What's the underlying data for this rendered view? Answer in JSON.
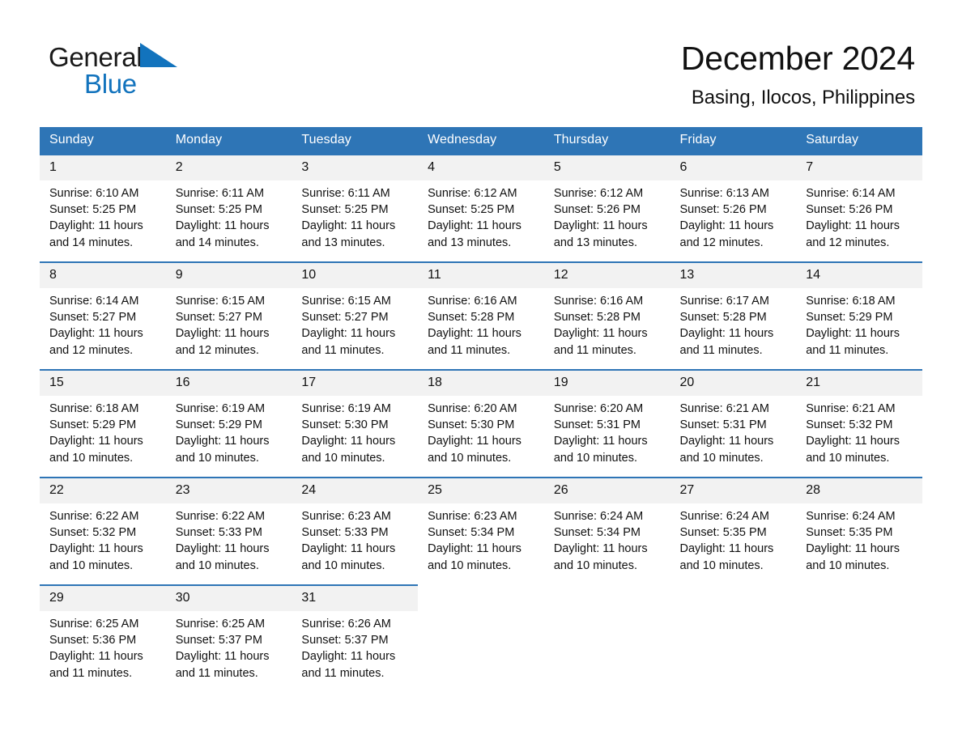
{
  "brand": {
    "name_part1": "General",
    "name_part2": "Blue",
    "triangle_color": "#1273bd",
    "text_color": "#1a1a1a"
  },
  "header": {
    "title": "December 2024",
    "subtitle": "Basing, Ilocos, Philippines"
  },
  "theme": {
    "header_blue": "#2e75b6",
    "daynum_bg": "#f2f2f2",
    "page_bg": "#ffffff",
    "text": "#111111"
  },
  "calendar": {
    "weekday_headers": [
      "Sunday",
      "Monday",
      "Tuesday",
      "Wednesday",
      "Thursday",
      "Friday",
      "Saturday"
    ],
    "weeks": [
      [
        {
          "day": "1",
          "sunrise": "Sunrise: 6:10 AM",
          "sunset": "Sunset: 5:25 PM",
          "daylight": "Daylight: 11 hours and 14 minutes."
        },
        {
          "day": "2",
          "sunrise": "Sunrise: 6:11 AM",
          "sunset": "Sunset: 5:25 PM",
          "daylight": "Daylight: 11 hours and 14 minutes."
        },
        {
          "day": "3",
          "sunrise": "Sunrise: 6:11 AM",
          "sunset": "Sunset: 5:25 PM",
          "daylight": "Daylight: 11 hours and 13 minutes."
        },
        {
          "day": "4",
          "sunrise": "Sunrise: 6:12 AM",
          "sunset": "Sunset: 5:25 PM",
          "daylight": "Daylight: 11 hours and 13 minutes."
        },
        {
          "day": "5",
          "sunrise": "Sunrise: 6:12 AM",
          "sunset": "Sunset: 5:26 PM",
          "daylight": "Daylight: 11 hours and 13 minutes."
        },
        {
          "day": "6",
          "sunrise": "Sunrise: 6:13 AM",
          "sunset": "Sunset: 5:26 PM",
          "daylight": "Daylight: 11 hours and 12 minutes."
        },
        {
          "day": "7",
          "sunrise": "Sunrise: 6:14 AM",
          "sunset": "Sunset: 5:26 PM",
          "daylight": "Daylight: 11 hours and 12 minutes."
        }
      ],
      [
        {
          "day": "8",
          "sunrise": "Sunrise: 6:14 AM",
          "sunset": "Sunset: 5:27 PM",
          "daylight": "Daylight: 11 hours and 12 minutes."
        },
        {
          "day": "9",
          "sunrise": "Sunrise: 6:15 AM",
          "sunset": "Sunset: 5:27 PM",
          "daylight": "Daylight: 11 hours and 12 minutes."
        },
        {
          "day": "10",
          "sunrise": "Sunrise: 6:15 AM",
          "sunset": "Sunset: 5:27 PM",
          "daylight": "Daylight: 11 hours and 11 minutes."
        },
        {
          "day": "11",
          "sunrise": "Sunrise: 6:16 AM",
          "sunset": "Sunset: 5:28 PM",
          "daylight": "Daylight: 11 hours and 11 minutes."
        },
        {
          "day": "12",
          "sunrise": "Sunrise: 6:16 AM",
          "sunset": "Sunset: 5:28 PM",
          "daylight": "Daylight: 11 hours and 11 minutes."
        },
        {
          "day": "13",
          "sunrise": "Sunrise: 6:17 AM",
          "sunset": "Sunset: 5:28 PM",
          "daylight": "Daylight: 11 hours and 11 minutes."
        },
        {
          "day": "14",
          "sunrise": "Sunrise: 6:18 AM",
          "sunset": "Sunset: 5:29 PM",
          "daylight": "Daylight: 11 hours and 11 minutes."
        }
      ],
      [
        {
          "day": "15",
          "sunrise": "Sunrise: 6:18 AM",
          "sunset": "Sunset: 5:29 PM",
          "daylight": "Daylight: 11 hours and 10 minutes."
        },
        {
          "day": "16",
          "sunrise": "Sunrise: 6:19 AM",
          "sunset": "Sunset: 5:29 PM",
          "daylight": "Daylight: 11 hours and 10 minutes."
        },
        {
          "day": "17",
          "sunrise": "Sunrise: 6:19 AM",
          "sunset": "Sunset: 5:30 PM",
          "daylight": "Daylight: 11 hours and 10 minutes."
        },
        {
          "day": "18",
          "sunrise": "Sunrise: 6:20 AM",
          "sunset": "Sunset: 5:30 PM",
          "daylight": "Daylight: 11 hours and 10 minutes."
        },
        {
          "day": "19",
          "sunrise": "Sunrise: 6:20 AM",
          "sunset": "Sunset: 5:31 PM",
          "daylight": "Daylight: 11 hours and 10 minutes."
        },
        {
          "day": "20",
          "sunrise": "Sunrise: 6:21 AM",
          "sunset": "Sunset: 5:31 PM",
          "daylight": "Daylight: 11 hours and 10 minutes."
        },
        {
          "day": "21",
          "sunrise": "Sunrise: 6:21 AM",
          "sunset": "Sunset: 5:32 PM",
          "daylight": "Daylight: 11 hours and 10 minutes."
        }
      ],
      [
        {
          "day": "22",
          "sunrise": "Sunrise: 6:22 AM",
          "sunset": "Sunset: 5:32 PM",
          "daylight": "Daylight: 11 hours and 10 minutes."
        },
        {
          "day": "23",
          "sunrise": "Sunrise: 6:22 AM",
          "sunset": "Sunset: 5:33 PM",
          "daylight": "Daylight: 11 hours and 10 minutes."
        },
        {
          "day": "24",
          "sunrise": "Sunrise: 6:23 AM",
          "sunset": "Sunset: 5:33 PM",
          "daylight": "Daylight: 11 hours and 10 minutes."
        },
        {
          "day": "25",
          "sunrise": "Sunrise: 6:23 AM",
          "sunset": "Sunset: 5:34 PM",
          "daylight": "Daylight: 11 hours and 10 minutes."
        },
        {
          "day": "26",
          "sunrise": "Sunrise: 6:24 AM",
          "sunset": "Sunset: 5:34 PM",
          "daylight": "Daylight: 11 hours and 10 minutes."
        },
        {
          "day": "27",
          "sunrise": "Sunrise: 6:24 AM",
          "sunset": "Sunset: 5:35 PM",
          "daylight": "Daylight: 11 hours and 10 minutes."
        },
        {
          "day": "28",
          "sunrise": "Sunrise: 6:24 AM",
          "sunset": "Sunset: 5:35 PM",
          "daylight": "Daylight: 11 hours and 10 minutes."
        }
      ],
      [
        {
          "day": "29",
          "sunrise": "Sunrise: 6:25 AM",
          "sunset": "Sunset: 5:36 PM",
          "daylight": "Daylight: 11 hours and 11 minutes."
        },
        {
          "day": "30",
          "sunrise": "Sunrise: 6:25 AM",
          "sunset": "Sunset: 5:37 PM",
          "daylight": "Daylight: 11 hours and 11 minutes."
        },
        {
          "day": "31",
          "sunrise": "Sunrise: 6:26 AM",
          "sunset": "Sunset: 5:37 PM",
          "daylight": "Daylight: 11 hours and 11 minutes."
        },
        {
          "day": "",
          "sunrise": "",
          "sunset": "",
          "daylight": ""
        },
        {
          "day": "",
          "sunrise": "",
          "sunset": "",
          "daylight": ""
        },
        {
          "day": "",
          "sunrise": "",
          "sunset": "",
          "daylight": ""
        },
        {
          "day": "",
          "sunrise": "",
          "sunset": "",
          "daylight": ""
        }
      ]
    ]
  }
}
